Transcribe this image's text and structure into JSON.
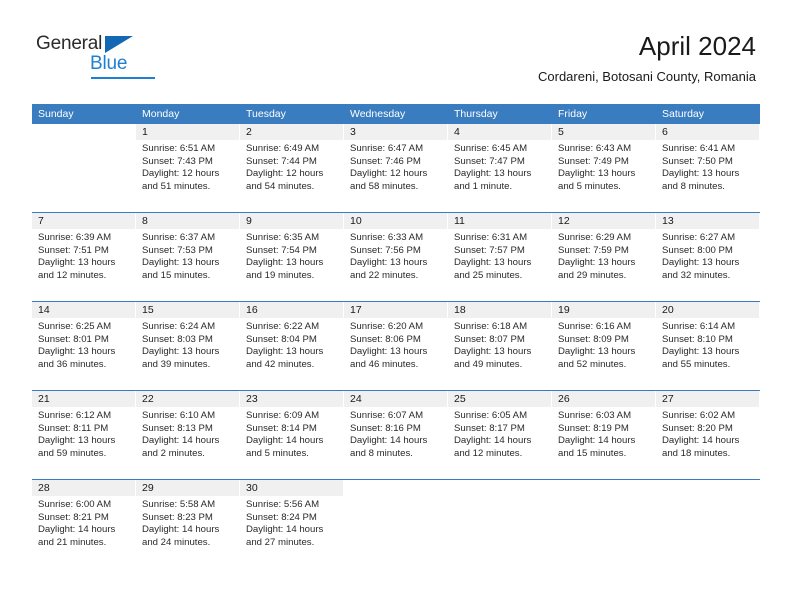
{
  "brand": {
    "name_part1": "General",
    "name_part2": "Blue",
    "accent_color": "#1268b3",
    "blue_text_color": "#1f7fd0"
  },
  "header": {
    "title": "April 2024",
    "subtitle": "Cordareni, Botosani County, Romania",
    "header_bg_color": "#3a7cc0",
    "day_band_color": "#f0f0f0"
  },
  "weekdays": [
    "Sunday",
    "Monday",
    "Tuesday",
    "Wednesday",
    "Thursday",
    "Friday",
    "Saturday"
  ],
  "weeks": [
    [
      {
        "day": "",
        "sunrise": "",
        "sunset": "",
        "daylight_line1": "",
        "daylight_line2": ""
      },
      {
        "day": "1",
        "sunrise": "Sunrise: 6:51 AM",
        "sunset": "Sunset: 7:43 PM",
        "daylight_line1": "Daylight: 12 hours",
        "daylight_line2": "and 51 minutes."
      },
      {
        "day": "2",
        "sunrise": "Sunrise: 6:49 AM",
        "sunset": "Sunset: 7:44 PM",
        "daylight_line1": "Daylight: 12 hours",
        "daylight_line2": "and 54 minutes."
      },
      {
        "day": "3",
        "sunrise": "Sunrise: 6:47 AM",
        "sunset": "Sunset: 7:46 PM",
        "daylight_line1": "Daylight: 12 hours",
        "daylight_line2": "and 58 minutes."
      },
      {
        "day": "4",
        "sunrise": "Sunrise: 6:45 AM",
        "sunset": "Sunset: 7:47 PM",
        "daylight_line1": "Daylight: 13 hours",
        "daylight_line2": "and 1 minute."
      },
      {
        "day": "5",
        "sunrise": "Sunrise: 6:43 AM",
        "sunset": "Sunset: 7:49 PM",
        "daylight_line1": "Daylight: 13 hours",
        "daylight_line2": "and 5 minutes."
      },
      {
        "day": "6",
        "sunrise": "Sunrise: 6:41 AM",
        "sunset": "Sunset: 7:50 PM",
        "daylight_line1": "Daylight: 13 hours",
        "daylight_line2": "and 8 minutes."
      }
    ],
    [
      {
        "day": "7",
        "sunrise": "Sunrise: 6:39 AM",
        "sunset": "Sunset: 7:51 PM",
        "daylight_line1": "Daylight: 13 hours",
        "daylight_line2": "and 12 minutes."
      },
      {
        "day": "8",
        "sunrise": "Sunrise: 6:37 AM",
        "sunset": "Sunset: 7:53 PM",
        "daylight_line1": "Daylight: 13 hours",
        "daylight_line2": "and 15 minutes."
      },
      {
        "day": "9",
        "sunrise": "Sunrise: 6:35 AM",
        "sunset": "Sunset: 7:54 PM",
        "daylight_line1": "Daylight: 13 hours",
        "daylight_line2": "and 19 minutes."
      },
      {
        "day": "10",
        "sunrise": "Sunrise: 6:33 AM",
        "sunset": "Sunset: 7:56 PM",
        "daylight_line1": "Daylight: 13 hours",
        "daylight_line2": "and 22 minutes."
      },
      {
        "day": "11",
        "sunrise": "Sunrise: 6:31 AM",
        "sunset": "Sunset: 7:57 PM",
        "daylight_line1": "Daylight: 13 hours",
        "daylight_line2": "and 25 minutes."
      },
      {
        "day": "12",
        "sunrise": "Sunrise: 6:29 AM",
        "sunset": "Sunset: 7:59 PM",
        "daylight_line1": "Daylight: 13 hours",
        "daylight_line2": "and 29 minutes."
      },
      {
        "day": "13",
        "sunrise": "Sunrise: 6:27 AM",
        "sunset": "Sunset: 8:00 PM",
        "daylight_line1": "Daylight: 13 hours",
        "daylight_line2": "and 32 minutes."
      }
    ],
    [
      {
        "day": "14",
        "sunrise": "Sunrise: 6:25 AM",
        "sunset": "Sunset: 8:01 PM",
        "daylight_line1": "Daylight: 13 hours",
        "daylight_line2": "and 36 minutes."
      },
      {
        "day": "15",
        "sunrise": "Sunrise: 6:24 AM",
        "sunset": "Sunset: 8:03 PM",
        "daylight_line1": "Daylight: 13 hours",
        "daylight_line2": "and 39 minutes."
      },
      {
        "day": "16",
        "sunrise": "Sunrise: 6:22 AM",
        "sunset": "Sunset: 8:04 PM",
        "daylight_line1": "Daylight: 13 hours",
        "daylight_line2": "and 42 minutes."
      },
      {
        "day": "17",
        "sunrise": "Sunrise: 6:20 AM",
        "sunset": "Sunset: 8:06 PM",
        "daylight_line1": "Daylight: 13 hours",
        "daylight_line2": "and 46 minutes."
      },
      {
        "day": "18",
        "sunrise": "Sunrise: 6:18 AM",
        "sunset": "Sunset: 8:07 PM",
        "daylight_line1": "Daylight: 13 hours",
        "daylight_line2": "and 49 minutes."
      },
      {
        "day": "19",
        "sunrise": "Sunrise: 6:16 AM",
        "sunset": "Sunset: 8:09 PM",
        "daylight_line1": "Daylight: 13 hours",
        "daylight_line2": "and 52 minutes."
      },
      {
        "day": "20",
        "sunrise": "Sunrise: 6:14 AM",
        "sunset": "Sunset: 8:10 PM",
        "daylight_line1": "Daylight: 13 hours",
        "daylight_line2": "and 55 minutes."
      }
    ],
    [
      {
        "day": "21",
        "sunrise": "Sunrise: 6:12 AM",
        "sunset": "Sunset: 8:11 PM",
        "daylight_line1": "Daylight: 13 hours",
        "daylight_line2": "and 59 minutes."
      },
      {
        "day": "22",
        "sunrise": "Sunrise: 6:10 AM",
        "sunset": "Sunset: 8:13 PM",
        "daylight_line1": "Daylight: 14 hours",
        "daylight_line2": "and 2 minutes."
      },
      {
        "day": "23",
        "sunrise": "Sunrise: 6:09 AM",
        "sunset": "Sunset: 8:14 PM",
        "daylight_line1": "Daylight: 14 hours",
        "daylight_line2": "and 5 minutes."
      },
      {
        "day": "24",
        "sunrise": "Sunrise: 6:07 AM",
        "sunset": "Sunset: 8:16 PM",
        "daylight_line1": "Daylight: 14 hours",
        "daylight_line2": "and 8 minutes."
      },
      {
        "day": "25",
        "sunrise": "Sunrise: 6:05 AM",
        "sunset": "Sunset: 8:17 PM",
        "daylight_line1": "Daylight: 14 hours",
        "daylight_line2": "and 12 minutes."
      },
      {
        "day": "26",
        "sunrise": "Sunrise: 6:03 AM",
        "sunset": "Sunset: 8:19 PM",
        "daylight_line1": "Daylight: 14 hours",
        "daylight_line2": "and 15 minutes."
      },
      {
        "day": "27",
        "sunrise": "Sunrise: 6:02 AM",
        "sunset": "Sunset: 8:20 PM",
        "daylight_line1": "Daylight: 14 hours",
        "daylight_line2": "and 18 minutes."
      }
    ],
    [
      {
        "day": "28",
        "sunrise": "Sunrise: 6:00 AM",
        "sunset": "Sunset: 8:21 PM",
        "daylight_line1": "Daylight: 14 hours",
        "daylight_line2": "and 21 minutes."
      },
      {
        "day": "29",
        "sunrise": "Sunrise: 5:58 AM",
        "sunset": "Sunset: 8:23 PM",
        "daylight_line1": "Daylight: 14 hours",
        "daylight_line2": "and 24 minutes."
      },
      {
        "day": "30",
        "sunrise": "Sunrise: 5:56 AM",
        "sunset": "Sunset: 8:24 PM",
        "daylight_line1": "Daylight: 14 hours",
        "daylight_line2": "and 27 minutes."
      },
      {
        "day": "",
        "sunrise": "",
        "sunset": "",
        "daylight_line1": "",
        "daylight_line2": ""
      },
      {
        "day": "",
        "sunrise": "",
        "sunset": "",
        "daylight_line1": "",
        "daylight_line2": ""
      },
      {
        "day": "",
        "sunrise": "",
        "sunset": "",
        "daylight_line1": "",
        "daylight_line2": ""
      },
      {
        "day": "",
        "sunrise": "",
        "sunset": "",
        "daylight_line1": "",
        "daylight_line2": ""
      }
    ]
  ]
}
